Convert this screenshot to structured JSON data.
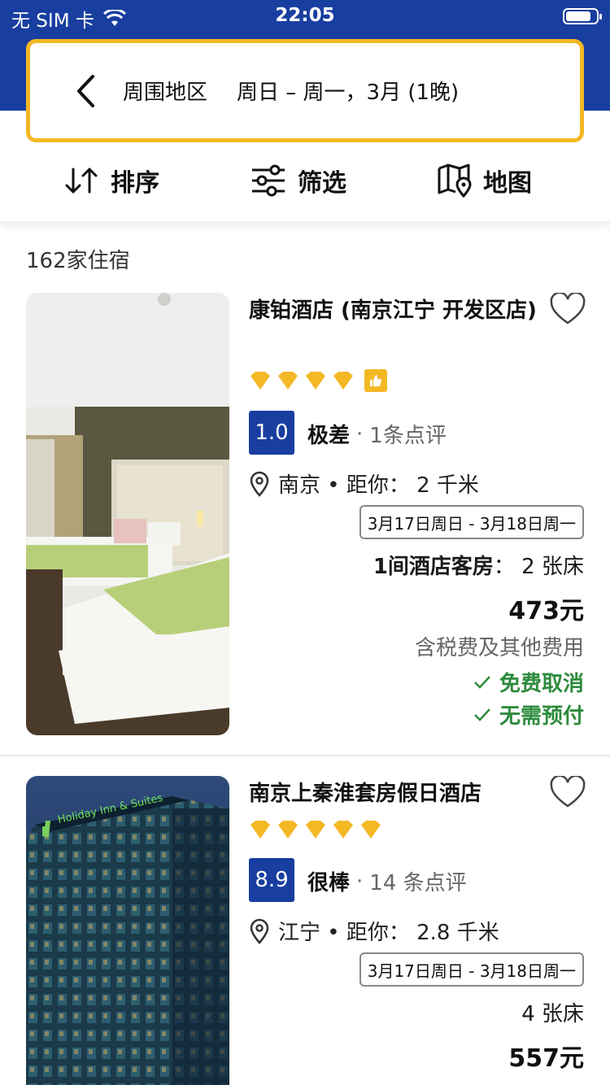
{
  "status_bar": {
    "carrier": "无 SIM 卡",
    "time": "22:05"
  },
  "search": {
    "area": "周围地区",
    "dates": "周日 – 周一，3月 (1晚)"
  },
  "toolbar": {
    "sort_label": "排序",
    "filter_label": "筛选",
    "map_label": "地图"
  },
  "results": {
    "count": "162家住宿"
  },
  "colors": {
    "brand_blue": "#183ea0",
    "accent_yellow": "#f4b825",
    "green": "#2e8b3d"
  },
  "hotels": [
    {
      "name": "康铂酒店 (南京江宁 开发区店)",
      "stars": 4,
      "thumbs_up": true,
      "score": "1.0",
      "score_label": "极差",
      "review_count": "1条点评",
      "location": "南京 • 距你： 2 千米",
      "dates": "3月17日周日 - 3月18日周一",
      "room_prefix": "1间酒店客房",
      "room_beds": "： 2 张床",
      "price": "473元",
      "tax_note": "含税费及其他费用",
      "perk1": "免费取消",
      "perk2": "无需预付"
    },
    {
      "name": "南京上秦淮套房假日酒店",
      "stars": 5,
      "score": "8.9",
      "score_label": "很棒",
      "review_count": "14 条点评",
      "location": "江宁 • 距你： 2.8 千米",
      "dates": "3月17日周日 - 3月18日周一",
      "beds": "4 张床",
      "price": "557元"
    }
  ]
}
